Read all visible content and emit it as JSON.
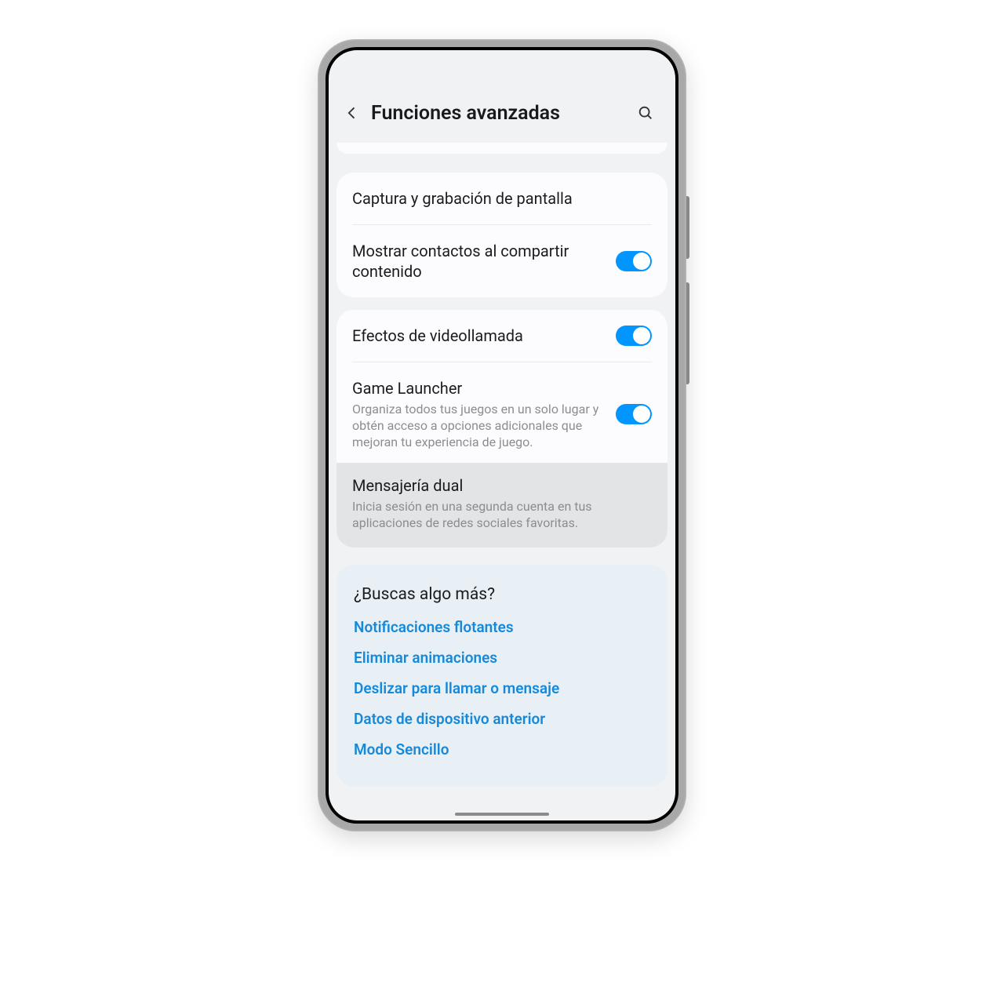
{
  "header": {
    "title": "Funciones avanzadas"
  },
  "rows": {
    "capture": {
      "title": "Captura y grabación de pantalla"
    },
    "contacts": {
      "title": "Mostrar contactos al compartir contenido"
    },
    "video": {
      "title": "Efectos de videollamada"
    },
    "game": {
      "title": "Game Launcher",
      "desc": "Organiza todos tus juegos en un solo lugar y obtén acceso a opciones adicionales que mejoran tu experiencia de juego."
    },
    "dual": {
      "title": "Mensajería dual",
      "desc": "Inicia sesión en una segunda cuenta en tus aplicaciones de redes sociales favoritas."
    }
  },
  "suggestions": {
    "title": "¿Buscas algo más?",
    "links": [
      "Notificaciones flotantes",
      "Eliminar animaciones",
      "Deslizar para llamar o mensaje",
      "Datos de dispositivo anterior",
      "Modo Sencillo"
    ]
  }
}
